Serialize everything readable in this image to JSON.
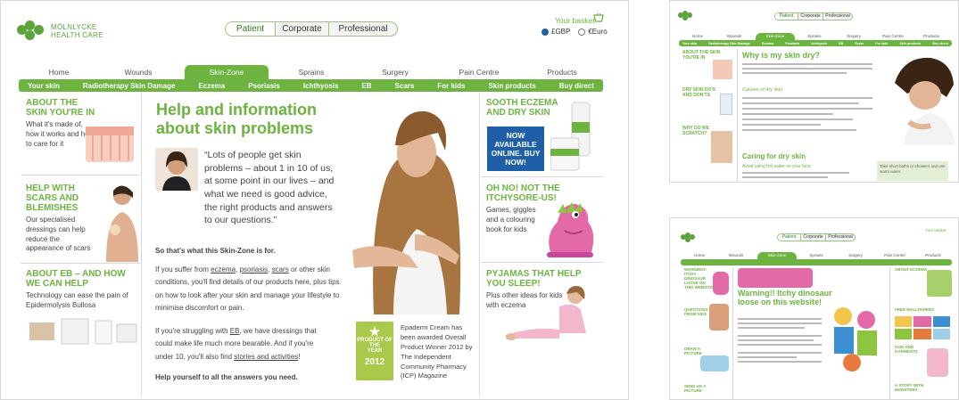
{
  "main": {
    "logo": {
      "line1": "MÖLNLYCKE",
      "line2": "HEALTH CARE"
    },
    "audience_tabs": [
      "Patient",
      "Corporate",
      "Professional"
    ],
    "basket": {
      "label": "Your basket",
      "currency_gbp": "£GBP",
      "currency_eur": "€Euro"
    },
    "nav_tabs": [
      "Home",
      "Wounds",
      "Skin-Zone",
      "Sprains",
      "Surgery",
      "Pain Centre",
      "Products"
    ],
    "sub_nav": [
      "Your skin",
      "Radiotherapy Skin Damage",
      "Eczema",
      "Psoriasis",
      "Ichthyosis",
      "EB",
      "Scars",
      "For kids",
      "Skin products",
      "Buy direct"
    ],
    "left": [
      {
        "title": "ABOUT THE SKIN YOU'RE IN",
        "text": "What it's made of, how it works and how to care for it"
      },
      {
        "title": "HELP WITH SCARS AND BLEMISHES",
        "text": "Our specialised dressings can help reduce the appearance of scars"
      },
      {
        "title": "ABOUT EB – AND HOW WE CAN HELP",
        "text": "Technology can ease the pain of Epidermolysis Bullosa"
      }
    ],
    "center": {
      "heading": "Help and information about skin problems",
      "quote": "“Lots of people get skin problems – about 1 in 10 of us, at some point in our lives – and what we need is good advice, the right products and answers to our questions.”",
      "skin_zone_for": "So that's what this Skin-Zone is for.",
      "p1_a": "If you suffer from ",
      "link_eczema": "eczema",
      "p1_b": ", ",
      "link_psoriasis": "psoriasis",
      "p1_c": ", ",
      "link_scars": "scars",
      "p1_d": " or other skin conditions, you'll find details of our products here, plus tips on how to look after your skin and manage your lifestyle to minimise discomfort or pain.",
      "p2_a": "If you're struggling with ",
      "link_eb": "EB",
      "p2_b": ", we have dressings that could make life much more bearable. And if you're under 10, you'll also find ",
      "link_stories": "stories and activities",
      "p2_c": "!",
      "closing": "Help yourself to all the answers you need.",
      "award_badge": {
        "line1": "PRODUCT OF THE",
        "line2": "YEAR",
        "year": "2012"
      },
      "award_text": "Epaderm Cream has been awarded Overall Product Winner 2012 by The Independent Community Pharmacy (ICP) Magazine"
    },
    "right": [
      {
        "title": "SOOTH ECZEMA AND DRY SKIN",
        "cta": "NOW AVAILABLE ONLINE. BUY NOW!"
      },
      {
        "title": "OH NO! NOT THE ITCHYSORE-US!",
        "text": "Games, giggles and a colouring book for kids"
      },
      {
        "title": "PYJAMAS THAT HELP YOU SLEEP!",
        "text": "Plus other ideas for kids with eczema"
      }
    ]
  },
  "thumb2": {
    "audience_tabs": [
      "Patient",
      "Corporate",
      "Professional"
    ],
    "nav_tabs": [
      "Home",
      "Wounds",
      "Skin-Zone",
      "Sprains",
      "Surgery",
      "Pain Centre",
      "Products"
    ],
    "sub_nav": [
      "Your skin",
      "Radiotherapy Skin Damage",
      "Eczema",
      "Psoriasis",
      "Ichthyosis",
      "EB",
      "Scars",
      "For kids",
      "Skin products",
      "Buy direct"
    ],
    "left": [
      "ABOUT THE SKIN YOU'RE IN",
      "DRY SKIN DO'S AND DON'TS",
      "WHY DO WE SCRATCH?"
    ],
    "heading": "Why is my skin dry?",
    "subheading": "Causes of dry skin",
    "heading2": "Caring for dry skin",
    "subheading2": "Avoid using hot water on your face",
    "tip": "Take short baths or showers and use warm water."
  },
  "thumb3": {
    "basket": "Your basket",
    "audience_tabs": [
      "Patient",
      "Corporate",
      "Professional"
    ],
    "nav_tabs": [
      "Home",
      "Wounds",
      "Skin-Zone",
      "Sprains",
      "Surgery",
      "Pain Centre",
      "Products"
    ],
    "left": [
      "WARNING!! ITCHY DINOSAUR LOOSE ON THIS WEBSITE!",
      "QUESTIONS FROM KIDS",
      "DRAW A PICTURE",
      "SEND US A PICTURE"
    ],
    "heading": "Warning!! Itchy dinosaur loose on this website!",
    "right": [
      "ABOUT ECZEMA",
      "FREE WALLPAPERS",
      "GOD AND GARMENTS",
      "A STORY WITH MONSTERS"
    ]
  },
  "colors": {
    "green": "#6cb33f",
    "blue": "#1f5fa8",
    "dark_green_text": "#2f7d1e"
  }
}
